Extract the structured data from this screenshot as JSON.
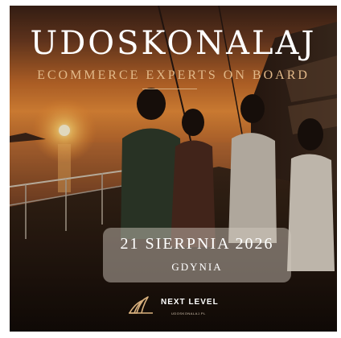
{
  "poster": {
    "title": "UDOSKONALAJ",
    "subtitle": "ECOMMERCE EXPERTS ON BOARD",
    "date": "21 SIERPNIA 2026",
    "city": "GDYNIA"
  },
  "brand": {
    "name": "NEXT LEVEL",
    "website": "UDOSKONALAJ.PL",
    "logo_icon": "stylized-chevron-logo-icon"
  },
  "colors": {
    "gold": "#e2b989",
    "sunset_orange": "#f28a2e",
    "dark_deck": "#1b120c"
  }
}
